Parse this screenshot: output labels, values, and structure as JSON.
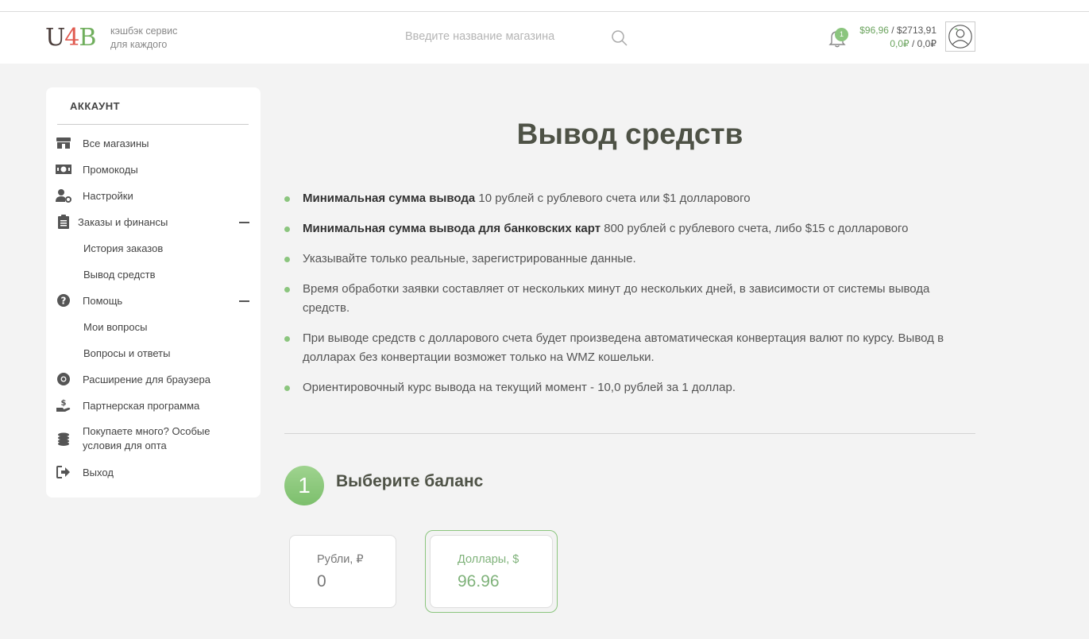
{
  "header": {
    "logo": {
      "u": "U",
      "four": "4",
      "b": "B"
    },
    "tagline_line1": "кэшбэк сервис",
    "tagline_line2": "для каждого",
    "search_placeholder": "Введите название магазина",
    "notification_count": "1",
    "balance_usd": "$96,96",
    "balance_usd_sep": " / ",
    "balance_usd_total": "$2713,91",
    "balance_rub": "0,0₽",
    "balance_rub_sep": " / ",
    "balance_rub_total": "0,0₽"
  },
  "sidebar": {
    "title": "АККАУНТ",
    "items": [
      {
        "label": "Все магазины",
        "icon": "store-icon"
      },
      {
        "label": "Промокоды",
        "icon": "money-icon"
      },
      {
        "label": "Настройки",
        "icon": "user-gear-icon"
      },
      {
        "label": "Заказы и финансы",
        "icon": "clipboard-icon"
      },
      {
        "label": "История заказов"
      },
      {
        "label": "Вывод средств"
      },
      {
        "label": "Помощь",
        "icon": "question-icon"
      },
      {
        "label": "Мои вопросы"
      },
      {
        "label": "Вопросы и ответы"
      },
      {
        "label": "Расширение для браузера",
        "icon": "chrome-icon"
      },
      {
        "label": "Партнерская программа",
        "icon": "hand-money-icon"
      },
      {
        "label": "Покупаете много? Особые",
        "label2": "условия для опта",
        "icon": "coins-icon"
      },
      {
        "label": "Выход",
        "icon": "sign-out-icon"
      }
    ]
  },
  "main": {
    "title": "Вывод средств",
    "bullets": [
      {
        "bold": "Минимальная сумма вывода",
        "text": " 10 рублей с рублевого счета или $1 долларового"
      },
      {
        "bold": "Минимальная сумма вывода для банковских карт",
        "text": " 800 рублей с рублевого счета, либо $15 с долларового"
      },
      {
        "bold": "",
        "text": "Указывайте только реальные, зарегистрированные данные."
      },
      {
        "bold": "",
        "text": "Время обработки заявки составляет от нескольких минут до нескольких дней, в зависимости от системы вывода средств."
      },
      {
        "bold": "",
        "text": "При выводе средств с долларового счета будет произведена автоматическая конвертация валют по курсу. Вывод в долларах без конвертации возможет только на WMZ кошельки."
      },
      {
        "bold": "",
        "text": "Ориентировочный курс вывода на текущий момент - 10,0 рублей за 1 доллар."
      }
    ],
    "step_number": "1",
    "step_title": "Выберите баланс",
    "balances": [
      {
        "name": "Рубли, ₽",
        "value": "0"
      },
      {
        "name": "Доллары, $",
        "value": "96.96"
      }
    ],
    "colors": {
      "accent": "#8bc57e",
      "title": "#4e5246"
    }
  }
}
